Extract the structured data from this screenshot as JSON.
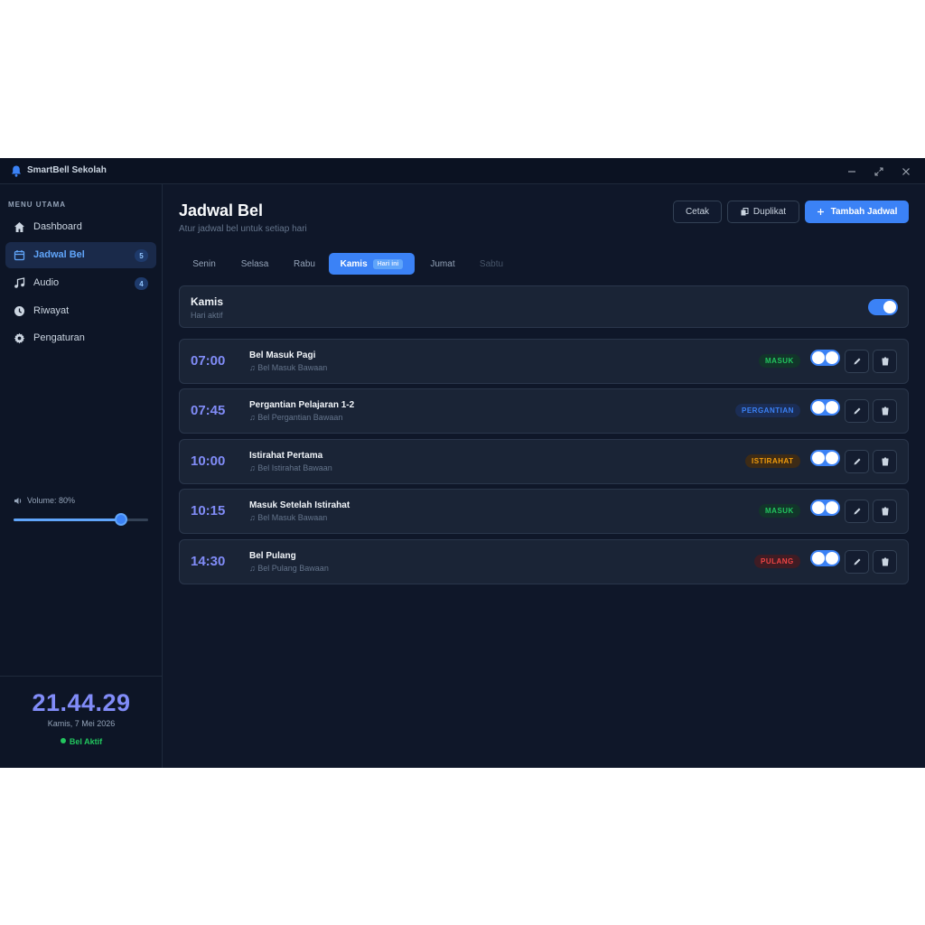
{
  "window": {
    "title": "SmartBell Sekolah"
  },
  "sidebar": {
    "heading": "MENU UTAMA",
    "items": [
      {
        "label": "Dashboard",
        "icon": "home-icon",
        "active": false,
        "badge": ""
      },
      {
        "label": "Jadwal Bel",
        "icon": "calendar-icon",
        "active": true,
        "badge": "5"
      },
      {
        "label": "Audio",
        "icon": "music-icon",
        "active": false,
        "badge": "4"
      },
      {
        "label": "Riwayat",
        "icon": "clock-icon",
        "active": false,
        "badge": ""
      },
      {
        "label": "Pengaturan",
        "icon": "gear-icon",
        "active": false,
        "badge": ""
      }
    ],
    "volume": {
      "label": "Volume: 80%",
      "value": 0.8
    },
    "clock": {
      "time": "21.44.29",
      "date": "Kamis, 7 Mei 2026",
      "status": "Bel Aktif"
    }
  },
  "header": {
    "title": "Jadwal Bel",
    "subtitle": "Atur jadwal bel untuk setiap hari",
    "print_label": "Cetak",
    "duplicate_label": "Duplikat",
    "add_label": "Tambah Jadwal"
  },
  "tabs": [
    {
      "label": "Senin",
      "state": "normal"
    },
    {
      "label": "Selasa",
      "state": "normal"
    },
    {
      "label": "Rabu",
      "state": "normal"
    },
    {
      "label": "Kamis",
      "state": "active",
      "badge": "Hari ini"
    },
    {
      "label": "Jumat",
      "state": "normal"
    },
    {
      "label": "Sabtu",
      "state": "disabled"
    }
  ],
  "day": {
    "name": "Kamis",
    "status": "Hari aktif",
    "enabled": true
  },
  "schedules": [
    {
      "time": "07:00",
      "name": "Bel Masuk Pagi",
      "audio": "Bel Masuk Bawaan",
      "type": "MASUK",
      "enabled": true
    },
    {
      "time": "07:45",
      "name": "Pergantian Pelajaran 1-2",
      "audio": "Bel Pergantian Bawaan",
      "type": "PERGANTIAN",
      "enabled": true
    },
    {
      "time": "10:00",
      "name": "Istirahat Pertama",
      "audio": "Bel Istirahat Bawaan",
      "type": "ISTIRAHAT",
      "enabled": true
    },
    {
      "time": "10:15",
      "name": "Masuk Setelah Istirahat",
      "audio": "Bel Masuk Bawaan",
      "type": "MASUK",
      "enabled": true
    },
    {
      "time": "14:30",
      "name": "Bel Pulang",
      "audio": "Bel Pulang Bawaan",
      "type": "PULANG",
      "enabled": true
    }
  ],
  "badge_colors": {
    "MASUK": {
      "bg": "#12352a",
      "fg": "#22c55e"
    },
    "PERGANTIAN": {
      "bg": "#1b2d55",
      "fg": "#3b82f6"
    },
    "ISTIRAHAT": {
      "bg": "#3d2b16",
      "fg": "#f59e0b"
    },
    "PULANG": {
      "bg": "#3f1c24",
      "fg": "#ef4444"
    }
  },
  "colors": {
    "accent": "#3b82f6",
    "time": "#818cf8",
    "background": "#0f1729"
  }
}
